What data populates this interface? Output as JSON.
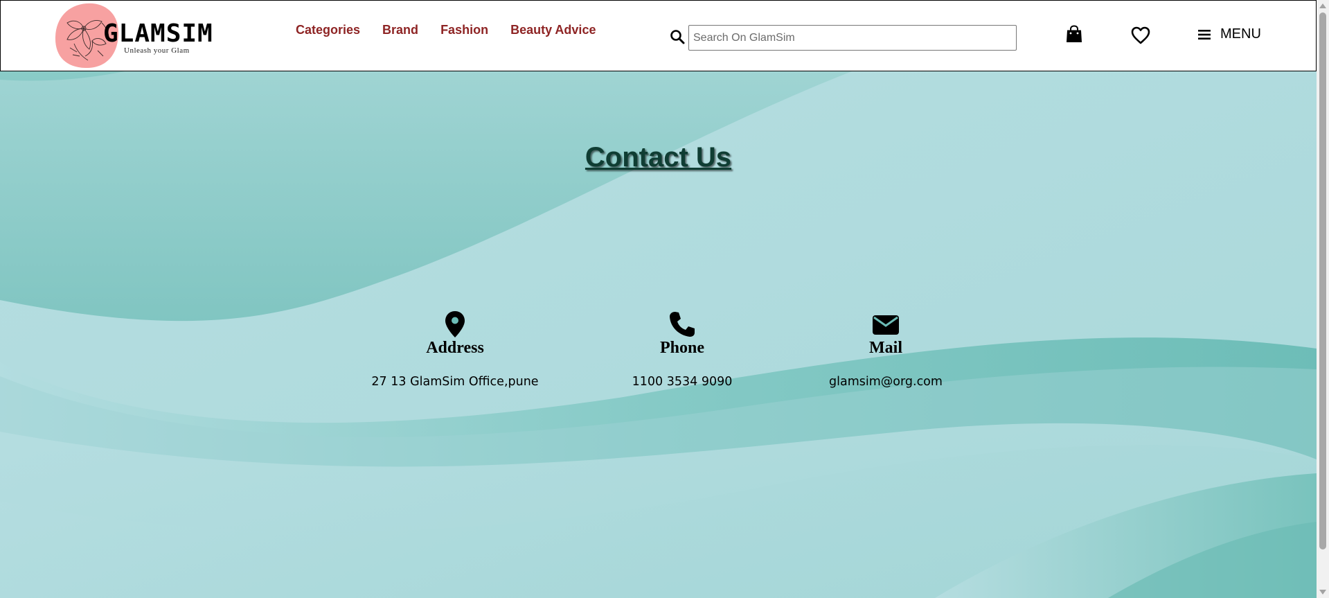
{
  "brand": {
    "name": "GLAMSIM",
    "tagline": "Unleash your Glam",
    "accent": "#8e2424",
    "blob_color": "#f7a1a1",
    "hero_colors": [
      "#68bdb6",
      "#b2dcdf"
    ]
  },
  "nav": {
    "items": [
      {
        "label": "Categories"
      },
      {
        "label": "Brand"
      },
      {
        "label": "Fashion"
      },
      {
        "label": "Beauty Advice"
      }
    ]
  },
  "search": {
    "placeholder": "Search On GlamSim",
    "value": ""
  },
  "header_actions": {
    "bag_icon": "shopping-bag-icon",
    "wishlist_icon": "heart-icon",
    "menu_icon": "hamburger-icon",
    "menu_label": "MENU"
  },
  "main": {
    "title": "Contact Us",
    "contacts": [
      {
        "icon": "map-pin-icon",
        "label": "Address",
        "value": "27 13 GlamSim Office,pune"
      },
      {
        "icon": "phone-icon",
        "label": "Phone",
        "value": "1100 3534 9090"
      },
      {
        "icon": "envelope-icon",
        "label": "Mail",
        "value": "glamsim@org.com"
      }
    ]
  }
}
